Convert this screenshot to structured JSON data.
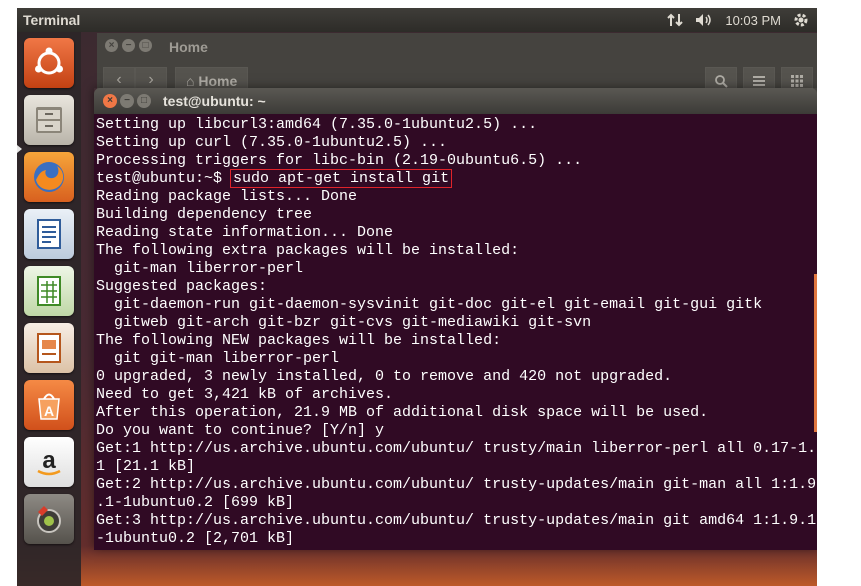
{
  "panel": {
    "title": "Terminal",
    "time": "10:03 PM",
    "icons": [
      "network-arrows-icon",
      "volume-icon",
      "gear-icon"
    ]
  },
  "launcher": {
    "items": [
      {
        "name": "ubuntu-dash-icon"
      },
      {
        "name": "files-icon"
      },
      {
        "name": "firefox-icon"
      },
      {
        "name": "writer-icon"
      },
      {
        "name": "calc-icon"
      },
      {
        "name": "impress-icon"
      },
      {
        "name": "software-center-icon"
      },
      {
        "name": "amazon-icon"
      },
      {
        "name": "system-settings-icon"
      }
    ]
  },
  "files_window": {
    "title": "Home",
    "crumb": "Home"
  },
  "terminal": {
    "title": "test@ubuntu: ~",
    "prompt": "test@ubuntu:~$ ",
    "command": "sudo apt-get install git",
    "lines_before": [
      "Setting up libcurl3:amd64 (7.35.0-1ubuntu2.5) ...",
      "Setting up curl (7.35.0-1ubuntu2.5) ...",
      "Processing triggers for libc-bin (2.19-0ubuntu6.5) ..."
    ],
    "lines_after": [
      "Reading package lists... Done",
      "Building dependency tree",
      "Reading state information... Done",
      "The following extra packages will be installed:",
      "  git-man liberror-perl",
      "Suggested packages:",
      "  git-daemon-run git-daemon-sysvinit git-doc git-el git-email git-gui gitk",
      "  gitweb git-arch git-bzr git-cvs git-mediawiki git-svn",
      "The following NEW packages will be installed:",
      "  git git-man liberror-perl",
      "0 upgraded, 3 newly installed, 0 to remove and 420 not upgraded.",
      "Need to get 3,421 kB of archives.",
      "After this operation, 21.9 MB of additional disk space will be used.",
      "Do you want to continue? [Y/n] y",
      "Get:1 http://us.archive.ubuntu.com/ubuntu/ trusty/main liberror-perl all 0.17-1.",
      "1 [21.1 kB]",
      "Get:2 http://us.archive.ubuntu.com/ubuntu/ trusty-updates/main git-man all 1:1.9",
      ".1-1ubuntu0.2 [699 kB]",
      "Get:3 http://us.archive.ubuntu.com/ubuntu/ trusty-updates/main git amd64 1:1.9.1",
      "-1ubuntu0.2 [2,701 kB]"
    ]
  },
  "colors": {
    "terminal_bg": "#300a24",
    "accent": "#f07746",
    "highlight_box": "#e0232a"
  }
}
